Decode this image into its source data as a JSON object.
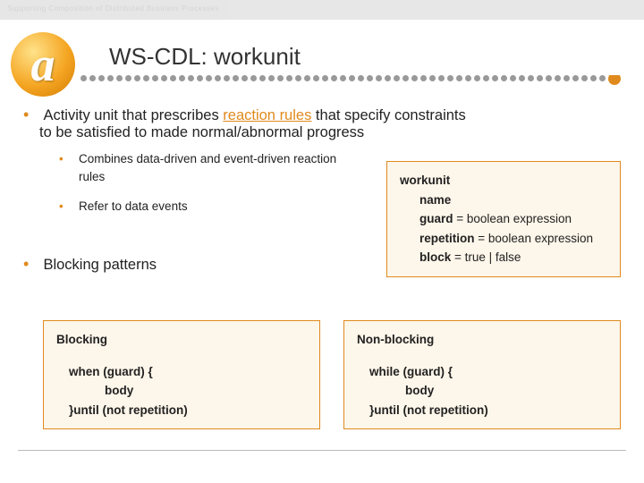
{
  "header": {
    "text": "Supporting Composition of Distributed Business Processes"
  },
  "logo": {
    "letter": "a"
  },
  "title": "WS-CDL: workunit",
  "main": {
    "bullet1_prefix": "Activity unit that prescribes ",
    "bullet1_highlight": "reaction rules",
    "bullet1_suffix": " that specify constraints",
    "bullet1_line2": "to be satisfied to made normal/abnormal progress",
    "sub1": "Combines data-driven and event-driven reaction rules",
    "sub2": "Refer to data events",
    "bullet2": "Blocking patterns"
  },
  "defbox": {
    "l1": "workunit",
    "l2": "name",
    "l3a": "guard",
    "l3b": " = boolean expression",
    "l4a": "repetition",
    "l4b": " = boolean expression",
    "l5a": "block",
    "l5b": " = true | false"
  },
  "patterns": {
    "left": {
      "title": "Blocking",
      "line1": "when (guard)  {",
      "line2": "body",
      "line3": "}until (not repetition)"
    },
    "right": {
      "title": "Non-blocking",
      "line1": "while (guard)  {",
      "line2": "body",
      "line3": "}until (not repetition)"
    }
  }
}
